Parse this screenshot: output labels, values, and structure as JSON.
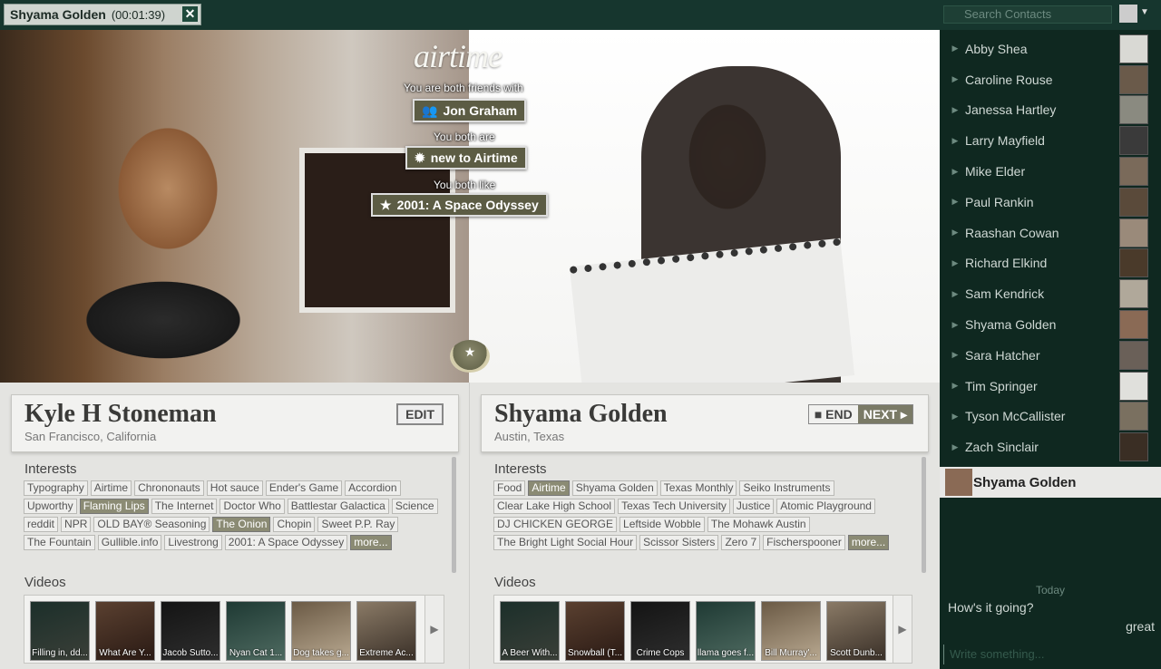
{
  "call": {
    "name": "Shyama Golden",
    "timer": "(00:01:39)"
  },
  "logo": "airtime",
  "common": [
    {
      "caption": "You are both friends with",
      "value": "Jon Graham",
      "icon": "friends-icon"
    },
    {
      "caption": "You both are",
      "value": "new to Airtime",
      "icon": "badge-icon"
    },
    {
      "caption": "You both like",
      "value": "2001: A Space Odyssey",
      "icon": "star-icon"
    }
  ],
  "left_profile": {
    "name": "Kyle H Stoneman",
    "location": "San Francisco, California",
    "action": "EDIT",
    "interests_label": "Interests",
    "videos_label": "Videos",
    "interests": [
      {
        "t": "Typography"
      },
      {
        "t": "Airtime"
      },
      {
        "t": "Chrononauts"
      },
      {
        "t": "Hot sauce"
      },
      {
        "t": "Ender's Game"
      },
      {
        "t": "Accordion"
      },
      {
        "t": "Upworthy"
      },
      {
        "t": "Flaming Lips",
        "hl": true
      },
      {
        "t": "The Internet"
      },
      {
        "t": "Doctor Who"
      },
      {
        "t": "Battlestar Galactica"
      },
      {
        "t": "Science"
      },
      {
        "t": "reddit"
      },
      {
        "t": "NPR"
      },
      {
        "t": "OLD BAY® Seasoning"
      },
      {
        "t": "The Onion",
        "hl": true
      },
      {
        "t": "Chopin"
      },
      {
        "t": "Sweet P.P. Ray"
      },
      {
        "t": "The Fountain"
      },
      {
        "t": "Gullible.info"
      },
      {
        "t": "Livestrong"
      },
      {
        "t": "2001: A Space Odyssey"
      }
    ],
    "more": "more...",
    "videos": [
      "Filling in, dd...",
      "What Are Y...",
      "Jacob Sutto...",
      "Nyan Cat 1...",
      "Dog takes g...",
      "Extreme Ac..."
    ]
  },
  "right_profile": {
    "name": "Shyama Golden",
    "location": "Austin, Texas",
    "end_label": "END",
    "next_label": "NEXT",
    "interests_label": "Interests",
    "videos_label": "Videos",
    "interests": [
      {
        "t": "Food"
      },
      {
        "t": "Airtime",
        "hl": true
      },
      {
        "t": "Shyama Golden"
      },
      {
        "t": "Texas Monthly"
      },
      {
        "t": "Seiko Instruments"
      },
      {
        "t": "Clear Lake High School"
      },
      {
        "t": "Texas Tech University"
      },
      {
        "t": "Justice"
      },
      {
        "t": "Atomic Playground"
      },
      {
        "t": "DJ CHICKEN GEORGE"
      },
      {
        "t": "Leftside Wobble"
      },
      {
        "t": "The Mohawk Austin"
      },
      {
        "t": "The Bright Light Social Hour"
      },
      {
        "t": "Scissor Sisters"
      },
      {
        "t": "Zero 7"
      },
      {
        "t": "Fischerspooner"
      }
    ],
    "more": "more...",
    "videos": [
      "A Beer With...",
      "Snowball (T...",
      "Crime Cops",
      "llama goes f...",
      "Bill Murray'...",
      "Scott Dunb..."
    ]
  },
  "sidebar": {
    "search_placeholder": "Search Contacts",
    "contacts": [
      "Abby Shea",
      "Caroline Rouse",
      "Janessa Hartley",
      "Larry Mayfield",
      "Mike Elder",
      "Paul Rankin",
      "Raashan Cowan",
      "Richard Elkind",
      "Sam Kendrick",
      "Shyama Golden",
      "Sara Hatcher",
      "Tim Springer",
      "Tyson McCallister",
      "Zach Sinclair"
    ]
  },
  "chat": {
    "name": "Shyama Golden",
    "date": "Today",
    "incoming": "How's it going?",
    "outgoing": "great",
    "placeholder": "Write something..."
  }
}
